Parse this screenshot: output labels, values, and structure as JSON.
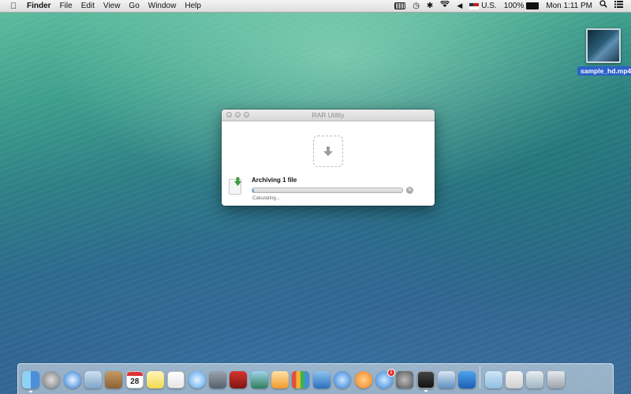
{
  "menubar": {
    "app_name": "Finder",
    "menus": [
      "File",
      "Edit",
      "View",
      "Go",
      "Window",
      "Help"
    ],
    "input_source": "U.S.",
    "battery_percent": "100%",
    "clock": "Mon 1:11 PM"
  },
  "desktop": {
    "file_name": "sample_hd.mp4"
  },
  "rar_window": {
    "title": "RAR Utility",
    "archiving_label": "Archiving 1 file",
    "status_label": "Calculating...",
    "progress_percent": 1
  },
  "dock": {
    "calendar_day": "28",
    "app_store_badge": "1",
    "items": [
      "finder-icon",
      "launchpad-icon",
      "safari-icon",
      "mail-icon",
      "contacts-icon",
      "calendar-icon",
      "notes-icon",
      "reminders-icon",
      "messages-icon",
      "facetime-icon",
      "photo-booth-icon",
      "iphoto-icon",
      "pages-icon",
      "numbers-icon",
      "keynote-icon",
      "itunes-icon",
      "ibooks-icon",
      "app-store-icon",
      "system-preferences-icon",
      "terminal-icon",
      "xcode-icon",
      "instruments-icon",
      "documents-folder-icon",
      "downloads-stack-icon",
      "preview-stack-icon",
      "trash-icon"
    ]
  }
}
